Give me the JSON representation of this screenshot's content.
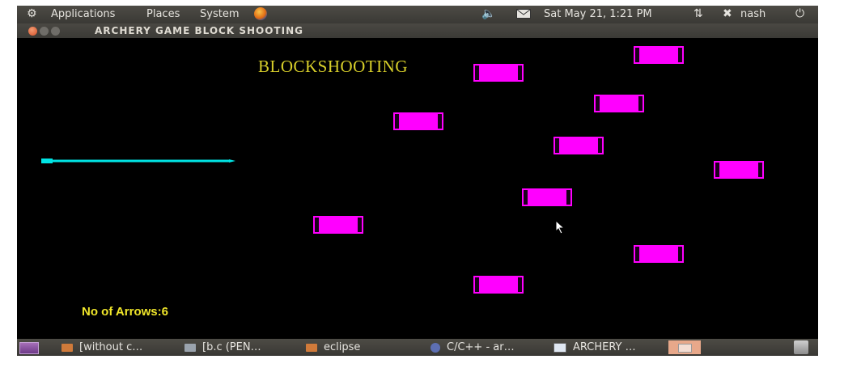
{
  "top_panel": {
    "applications": "Applications",
    "places": "Places",
    "system": "System",
    "datetime": "Sat May 21,  1:21 PM",
    "user": "nash"
  },
  "window": {
    "title": "ARCHERY GAME BLOCK SHOOTING"
  },
  "game": {
    "title": "BLOCKSHOOTING",
    "arrows_label": "No of Arrows:6",
    "block_color": "#ff00ff",
    "arrow_color": "#00e5e5",
    "text_color": "#f0e62a"
  },
  "taskbar": {
    "items": [
      {
        "label": "[without c…",
        "icon": "folder-icon"
      },
      {
        "label": "[b.c (PEN…",
        "icon": "text-editor-icon"
      },
      {
        "label": "eclipse",
        "icon": "folder-icon"
      },
      {
        "label": "C/C++ - ar…",
        "icon": "eclipse-icon"
      },
      {
        "label": "ARCHERY …",
        "icon": "window-icon"
      }
    ]
  }
}
